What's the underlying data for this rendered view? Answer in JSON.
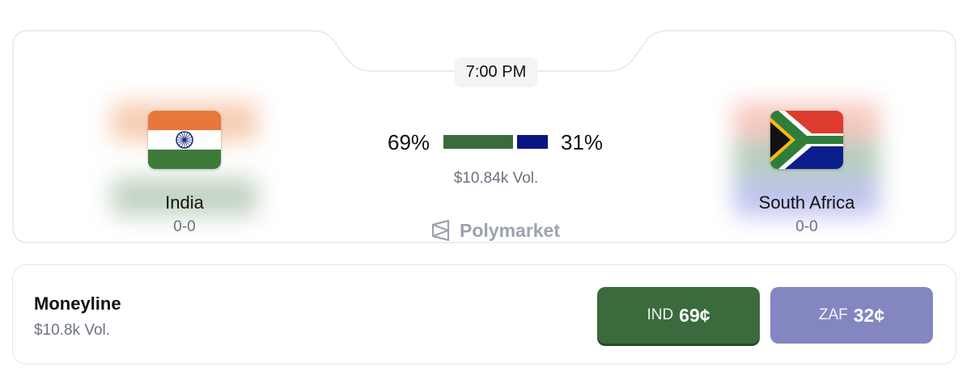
{
  "match": {
    "time": "7:00 PM",
    "volume": "$10.84k Vol.",
    "brand": "Polymarket",
    "teams": {
      "home": {
        "name": "India",
        "record": "0-0",
        "probability": 0.69,
        "probability_label": "69%",
        "bar_color": "#3b6a3c",
        "flag": "india-flag"
      },
      "away": {
        "name": "South Africa",
        "record": "0-0",
        "probability": 0.31,
        "probability_label": "31%",
        "bar_color": "#0b1483",
        "flag": "south-africa-flag"
      }
    }
  },
  "moneyline": {
    "title": "Moneyline",
    "volume": "$10.8k Vol.",
    "buttons": [
      {
        "code": "IND",
        "price": "69¢",
        "color": "#3b6a3c"
      },
      {
        "code": "ZAF",
        "price": "32¢",
        "color": "#8486c2"
      }
    ]
  }
}
